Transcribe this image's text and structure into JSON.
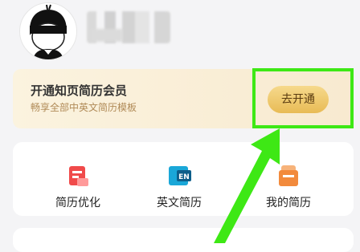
{
  "membership": {
    "title": "开通知页简历会员",
    "subtitle": "畅享全部中英文简历模板",
    "button_label": "去开通"
  },
  "tools": [
    {
      "label": "简历优化",
      "icon": "resume-optimize-icon"
    },
    {
      "label": "英文简历",
      "icon": "english-resume-icon"
    },
    {
      "label": "我的简历",
      "icon": "my-resume-icon"
    }
  ],
  "colors": {
    "highlight": "#3ee815",
    "vip_button": "#e8bb55",
    "vip_sub_text": "#b08a57"
  },
  "english_icon_text": "EN"
}
